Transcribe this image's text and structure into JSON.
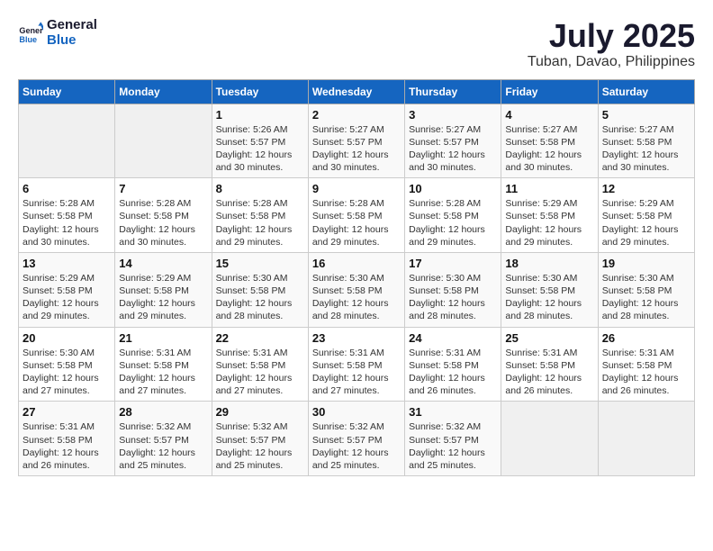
{
  "header": {
    "logo_line1": "General",
    "logo_line2": "Blue",
    "month_year": "July 2025",
    "location": "Tuban, Davao, Philippines"
  },
  "calendar": {
    "weekdays": [
      "Sunday",
      "Monday",
      "Tuesday",
      "Wednesday",
      "Thursday",
      "Friday",
      "Saturday"
    ],
    "weeks": [
      [
        {
          "day": "",
          "info": ""
        },
        {
          "day": "",
          "info": ""
        },
        {
          "day": "1",
          "info": "Sunrise: 5:26 AM\nSunset: 5:57 PM\nDaylight: 12 hours\nand 30 minutes."
        },
        {
          "day": "2",
          "info": "Sunrise: 5:27 AM\nSunset: 5:57 PM\nDaylight: 12 hours\nand 30 minutes."
        },
        {
          "day": "3",
          "info": "Sunrise: 5:27 AM\nSunset: 5:57 PM\nDaylight: 12 hours\nand 30 minutes."
        },
        {
          "day": "4",
          "info": "Sunrise: 5:27 AM\nSunset: 5:58 PM\nDaylight: 12 hours\nand 30 minutes."
        },
        {
          "day": "5",
          "info": "Sunrise: 5:27 AM\nSunset: 5:58 PM\nDaylight: 12 hours\nand 30 minutes."
        }
      ],
      [
        {
          "day": "6",
          "info": "Sunrise: 5:28 AM\nSunset: 5:58 PM\nDaylight: 12 hours\nand 30 minutes."
        },
        {
          "day": "7",
          "info": "Sunrise: 5:28 AM\nSunset: 5:58 PM\nDaylight: 12 hours\nand 30 minutes."
        },
        {
          "day": "8",
          "info": "Sunrise: 5:28 AM\nSunset: 5:58 PM\nDaylight: 12 hours\nand 29 minutes."
        },
        {
          "day": "9",
          "info": "Sunrise: 5:28 AM\nSunset: 5:58 PM\nDaylight: 12 hours\nand 29 minutes."
        },
        {
          "day": "10",
          "info": "Sunrise: 5:28 AM\nSunset: 5:58 PM\nDaylight: 12 hours\nand 29 minutes."
        },
        {
          "day": "11",
          "info": "Sunrise: 5:29 AM\nSunset: 5:58 PM\nDaylight: 12 hours\nand 29 minutes."
        },
        {
          "day": "12",
          "info": "Sunrise: 5:29 AM\nSunset: 5:58 PM\nDaylight: 12 hours\nand 29 minutes."
        }
      ],
      [
        {
          "day": "13",
          "info": "Sunrise: 5:29 AM\nSunset: 5:58 PM\nDaylight: 12 hours\nand 29 minutes."
        },
        {
          "day": "14",
          "info": "Sunrise: 5:29 AM\nSunset: 5:58 PM\nDaylight: 12 hours\nand 29 minutes."
        },
        {
          "day": "15",
          "info": "Sunrise: 5:30 AM\nSunset: 5:58 PM\nDaylight: 12 hours\nand 28 minutes."
        },
        {
          "day": "16",
          "info": "Sunrise: 5:30 AM\nSunset: 5:58 PM\nDaylight: 12 hours\nand 28 minutes."
        },
        {
          "day": "17",
          "info": "Sunrise: 5:30 AM\nSunset: 5:58 PM\nDaylight: 12 hours\nand 28 minutes."
        },
        {
          "day": "18",
          "info": "Sunrise: 5:30 AM\nSunset: 5:58 PM\nDaylight: 12 hours\nand 28 minutes."
        },
        {
          "day": "19",
          "info": "Sunrise: 5:30 AM\nSunset: 5:58 PM\nDaylight: 12 hours\nand 28 minutes."
        }
      ],
      [
        {
          "day": "20",
          "info": "Sunrise: 5:30 AM\nSunset: 5:58 PM\nDaylight: 12 hours\nand 27 minutes."
        },
        {
          "day": "21",
          "info": "Sunrise: 5:31 AM\nSunset: 5:58 PM\nDaylight: 12 hours\nand 27 minutes."
        },
        {
          "day": "22",
          "info": "Sunrise: 5:31 AM\nSunset: 5:58 PM\nDaylight: 12 hours\nand 27 minutes."
        },
        {
          "day": "23",
          "info": "Sunrise: 5:31 AM\nSunset: 5:58 PM\nDaylight: 12 hours\nand 27 minutes."
        },
        {
          "day": "24",
          "info": "Sunrise: 5:31 AM\nSunset: 5:58 PM\nDaylight: 12 hours\nand 26 minutes."
        },
        {
          "day": "25",
          "info": "Sunrise: 5:31 AM\nSunset: 5:58 PM\nDaylight: 12 hours\nand 26 minutes."
        },
        {
          "day": "26",
          "info": "Sunrise: 5:31 AM\nSunset: 5:58 PM\nDaylight: 12 hours\nand 26 minutes."
        }
      ],
      [
        {
          "day": "27",
          "info": "Sunrise: 5:31 AM\nSunset: 5:58 PM\nDaylight: 12 hours\nand 26 minutes."
        },
        {
          "day": "28",
          "info": "Sunrise: 5:32 AM\nSunset: 5:57 PM\nDaylight: 12 hours\nand 25 minutes."
        },
        {
          "day": "29",
          "info": "Sunrise: 5:32 AM\nSunset: 5:57 PM\nDaylight: 12 hours\nand 25 minutes."
        },
        {
          "day": "30",
          "info": "Sunrise: 5:32 AM\nSunset: 5:57 PM\nDaylight: 12 hours\nand 25 minutes."
        },
        {
          "day": "31",
          "info": "Sunrise: 5:32 AM\nSunset: 5:57 PM\nDaylight: 12 hours\nand 25 minutes."
        },
        {
          "day": "",
          "info": ""
        },
        {
          "day": "",
          "info": ""
        }
      ]
    ]
  }
}
